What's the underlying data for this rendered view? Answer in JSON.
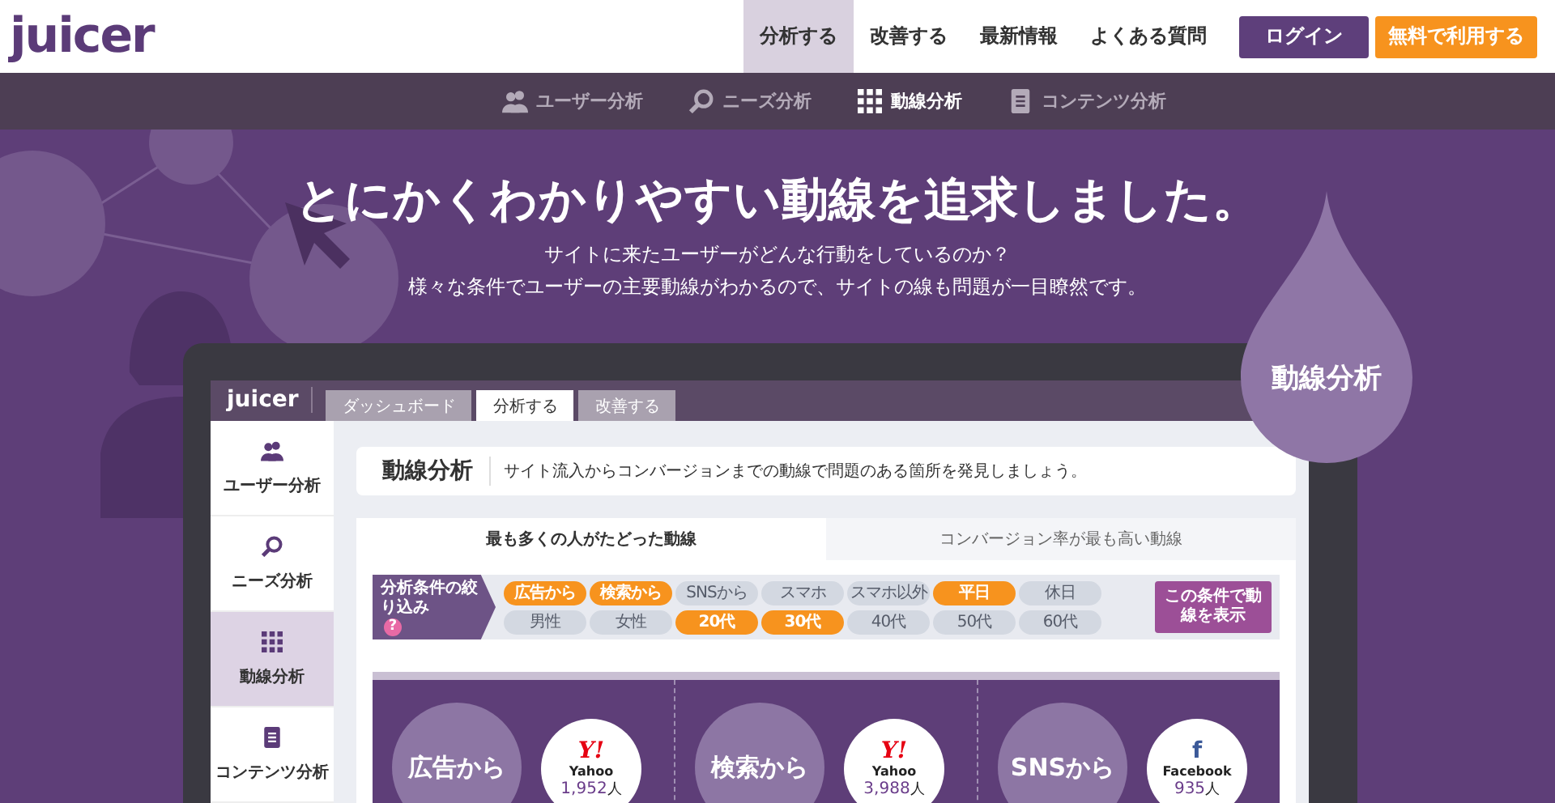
{
  "header": {
    "logo": "juicer",
    "nav": [
      {
        "label": "分析する",
        "selected": true
      },
      {
        "label": "改善する",
        "selected": false
      },
      {
        "label": "最新情報",
        "selected": false
      },
      {
        "label": "よくある質問",
        "selected": false
      }
    ],
    "login_button": "ログイン",
    "signup_button": "無料で利用する"
  },
  "subnav": [
    {
      "label": "ユーザー分析",
      "selected": false
    },
    {
      "label": "ニーズ分析",
      "selected": false
    },
    {
      "label": "動線分析",
      "selected": true
    },
    {
      "label": "コンテンツ分析",
      "selected": false
    }
  ],
  "hero": {
    "title": "とにかくわかりやすい動線を追求しました。",
    "subtitle_lines": [
      "サイトに来たユーザーがどんな行動をしているのか？",
      "様々な条件でユーザーの主要動線がわかるので、サイトの線も問題が一目瞭然です。"
    ],
    "drop_label": "動線分析"
  },
  "app": {
    "logo": "juicer",
    "tabs": [
      {
        "label": "ダッシュボード",
        "selected": false
      },
      {
        "label": "分析する",
        "selected": true
      },
      {
        "label": "改善する",
        "selected": false
      }
    ],
    "sidebar": [
      {
        "label": "ユーザー分析",
        "selected": false
      },
      {
        "label": "ニーズ分析",
        "selected": false
      },
      {
        "label": "動線分析",
        "selected": true
      },
      {
        "label": "コンテンツ分析",
        "selected": false
      }
    ],
    "page_title": "動線分析",
    "page_description": "サイト流入からコンバージョンまでの動線で問題のある箇所を発見しましょう。",
    "view_tabs": [
      {
        "label": "最も多くの人がたどった動線",
        "selected": true
      },
      {
        "label": "コンバージョン率が最も高い動線",
        "selected": false
      }
    ],
    "filter": {
      "label": "分析条件の絞り込み",
      "help": "?",
      "chips": [
        {
          "label": "広告から",
          "selected": true
        },
        {
          "label": "検索から",
          "selected": true
        },
        {
          "label": "SNSから",
          "selected": false
        },
        {
          "label": "スマホ",
          "selected": false
        },
        {
          "label": "スマホ以外",
          "selected": false
        },
        {
          "label": "平日",
          "selected": true
        },
        {
          "label": "休日",
          "selected": false
        },
        {
          "label": "男性",
          "selected": false
        },
        {
          "label": "女性",
          "selected": false
        },
        {
          "label": "20代",
          "selected": true
        },
        {
          "label": "30代",
          "selected": true
        },
        {
          "label": "40代",
          "selected": false
        },
        {
          "label": "50代",
          "selected": false
        },
        {
          "label": "60代",
          "selected": false
        }
      ],
      "apply_button": "この条件で動線を表示"
    },
    "flows": [
      {
        "source": "広告から",
        "site": {
          "kind": "yahoo",
          "logo": "Y!",
          "name": "Yahoo",
          "count": "1,952",
          "unit": "人"
        }
      },
      {
        "source": "検索から",
        "site": {
          "kind": "yahoo",
          "logo": "Y!",
          "name": "Yahoo",
          "count": "3,988",
          "unit": "人"
        }
      },
      {
        "source": "SNSから",
        "site": {
          "kind": "facebook",
          "logo": "f",
          "name": "Facebook",
          "count": "935",
          "unit": "人"
        }
      }
    ]
  }
}
